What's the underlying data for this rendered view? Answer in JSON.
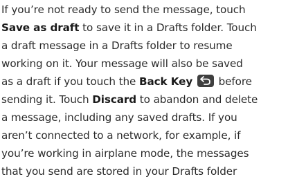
{
  "paragraph": {
    "l1": "If you’re not ready to send the message, touch",
    "l2_bold": "Save as draft",
    "l2_rest": " to save it in a Drafts folder. Touch",
    "l3": "a draft message in a Drafts folder to resume",
    "l4": "working on it. Your message will also be saved",
    "l5_pre": "as a draft if you touch the ",
    "l5_bold": "Back Key",
    "l6": "sending it. Touch ",
    "l6_bold": "Discard",
    "l6_rest": " to abandon and delete",
    "l7": "a message, including any saved drafts. If you",
    "l8": "aren’t connected to a network, for example, if",
    "l9": "you’re working in airplane mode, the messages",
    "l10": "that you send are stored in your Drafts folder",
    "before": "before"
  },
  "icons": {
    "back_key": "back-arrow-icon"
  }
}
